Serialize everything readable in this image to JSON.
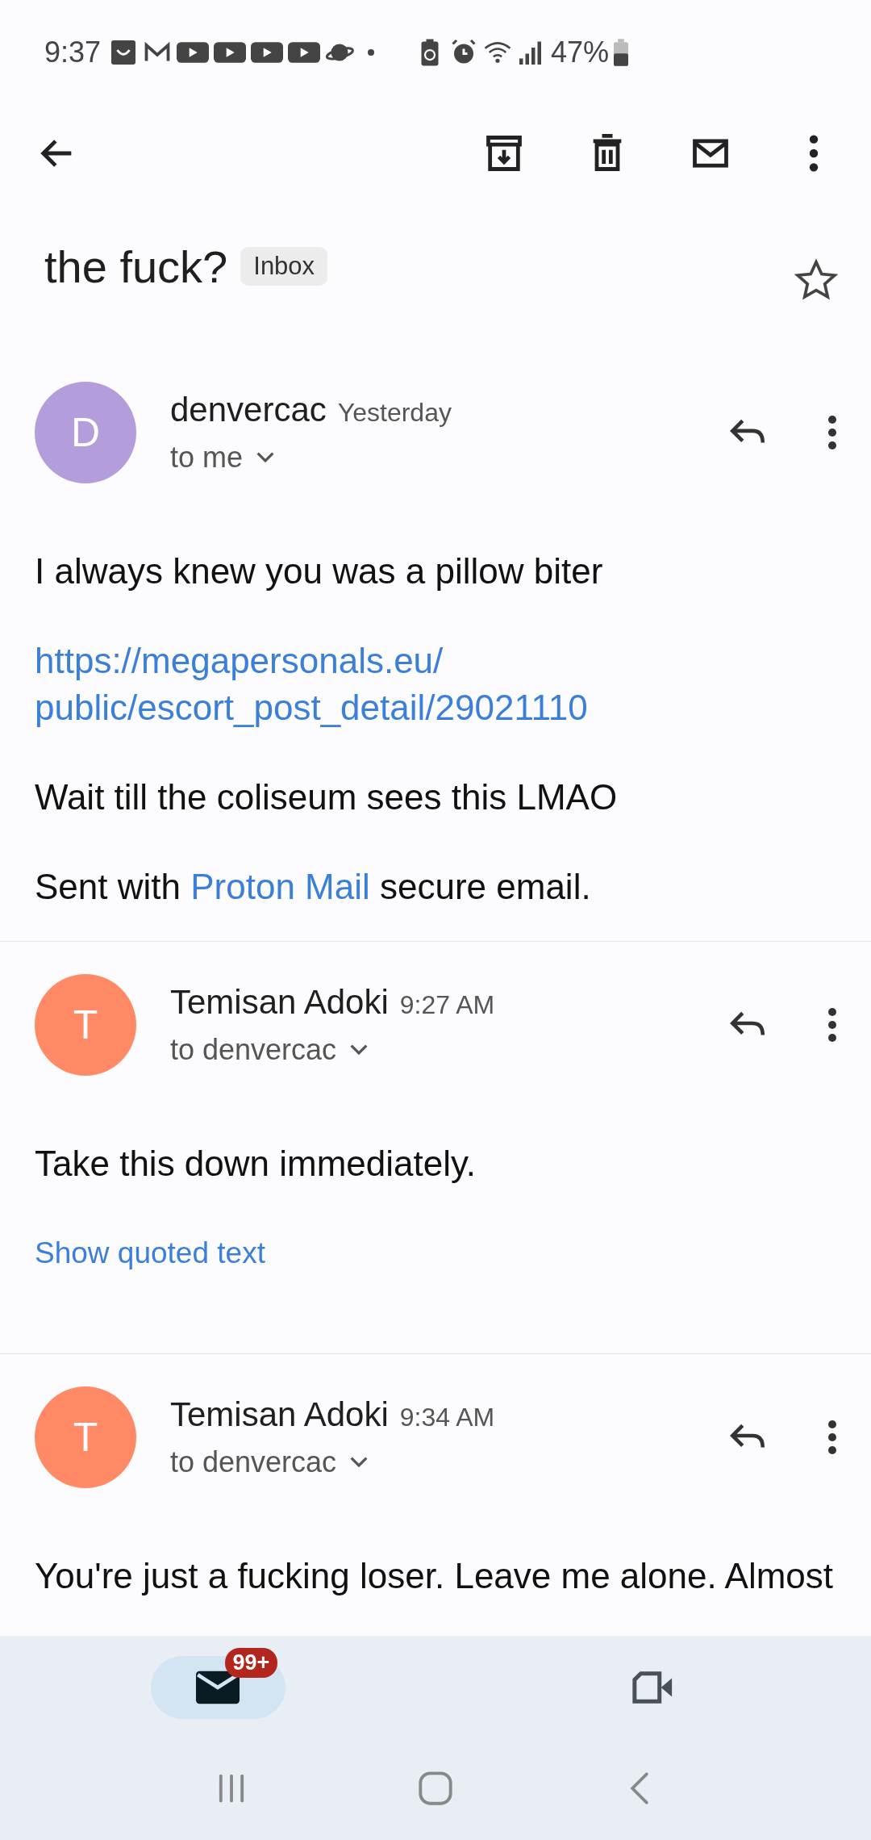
{
  "status_bar": {
    "time": "9:37",
    "battery": "47%"
  },
  "subject": {
    "title": "the fuck?",
    "label": "Inbox",
    "starred": false
  },
  "messages": [
    {
      "sender": "denvercac",
      "initial": "D",
      "color": "#b39ddb",
      "time": "Yesterday",
      "recipient": "to me",
      "body": [
        {
          "kind": "text",
          "text": "I always knew you was a pillow biter"
        },
        {
          "kind": "link",
          "lines": [
            "https://megapersonals.eu/",
            "public/escort_post_detail/29021110"
          ]
        },
        {
          "kind": "text",
          "text": "Wait till the coliseum sees this LMAO"
        },
        {
          "kind": "mixed",
          "parts": [
            {
              "kind": "text",
              "text": "Sent with "
            },
            {
              "kind": "link",
              "text": "Proton Mail"
            },
            {
              "kind": "text",
              "text": " secure email."
            }
          ]
        }
      ]
    },
    {
      "sender": "Temisan Adoki",
      "initial": "T",
      "color": "#ff8a65",
      "time": "9:27 AM",
      "recipient": "to denvercac",
      "body": [
        {
          "kind": "text",
          "text": "Take this down immediately."
        },
        {
          "kind": "toggle",
          "text": "Show quoted text"
        }
      ]
    },
    {
      "sender": "Temisan Adoki",
      "initial": "T",
      "color": "#ff8a65",
      "time": "9:34 AM",
      "recipient": "to denvercac",
      "body": [
        {
          "kind": "text",
          "text": "You're just a fucking loser. Leave me alone. Almost"
        }
      ]
    }
  ],
  "bottom_nav": [
    {
      "kind": "mail",
      "selected": true,
      "badge": "99+"
    },
    {
      "kind": "meet",
      "selected": false
    }
  ]
}
